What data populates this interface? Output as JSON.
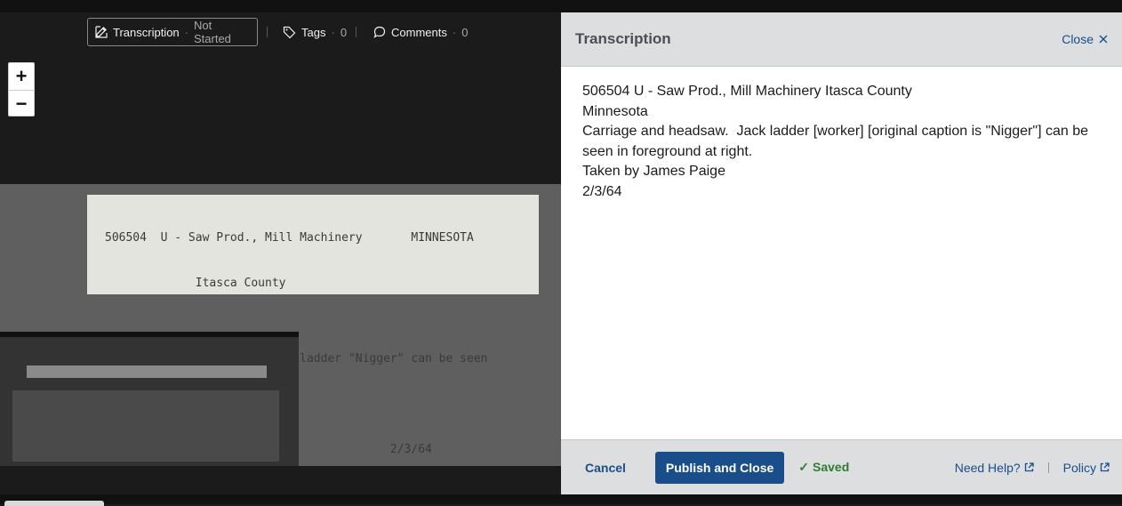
{
  "toolbar": {
    "transcription_label": "Transcription",
    "transcription_status": "Not Started",
    "tags_label": "Tags",
    "tags_count": "0",
    "comments_label": "Comments",
    "comments_count": "0"
  },
  "zoom": {
    "in": "+",
    "out": "−"
  },
  "photo": {
    "card_lines": [
      "506504  U - Saw Prod., Mill Machinery       MINNESOTA",
      "             Itasca County",
      "",
      "Carriage and headsaw.  Jack ladder \"Nigger\" can be seen",
      "in foreground at right.",
      "Taken by James Falge                     2/3/64"
    ]
  },
  "panel": {
    "title": "Transcription",
    "close_label": "Close",
    "text": "506504 U - Saw Prod., Mill Machinery Itasca County\nMinnesota\nCarriage and headsaw.  Jack ladder [worker] [original caption is \"Nigger\"] can be seen in foreground at right.\nTaken by James Paige\n2/3/64",
    "cancel_label": "Cancel",
    "publish_label": "Publish and Close",
    "saved_label": "Saved",
    "help_label": "Need Help?",
    "policy_label": "Policy"
  },
  "colors": {
    "accent": "#1a4e8a",
    "saved": "#2e7d32"
  }
}
